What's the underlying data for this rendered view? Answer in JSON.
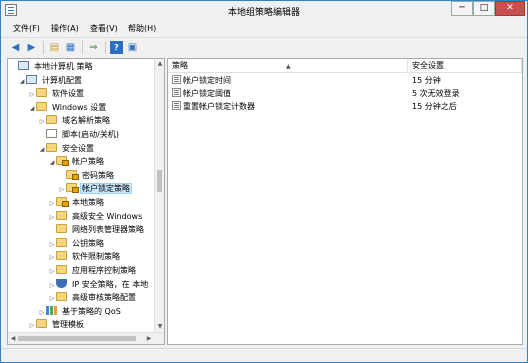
{
  "window": {
    "title": "本地组策略编辑器",
    "controls": {
      "minimize": "─",
      "maximize": "□",
      "close": "✕"
    }
  },
  "menubar": {
    "items": [
      {
        "label": "文件(F)"
      },
      {
        "label": "操作(A)"
      },
      {
        "label": "查看(V)"
      },
      {
        "label": "帮助(H)"
      }
    ]
  },
  "toolbar": {
    "back_icon": "back-arrow-icon",
    "forward_icon": "forward-arrow-icon",
    "up_icon": "up-folder-icon",
    "show_tree_icon": "show-hide-tree-icon",
    "export_icon": "export-list-icon",
    "help_icon": "help-icon",
    "properties_icon": "properties-icon"
  },
  "tree": [
    {
      "label": "本地计算机 策略",
      "icon": "computer",
      "expander": "",
      "selected": false
    },
    {
      "label": "计算机配置",
      "icon": "computer",
      "expander": "◢",
      "selected": false
    },
    {
      "label": "软件设置",
      "icon": "folder",
      "expander": "▷",
      "selected": false
    },
    {
      "label": "Windows 设置",
      "icon": "folder",
      "expander": "◢",
      "selected": false
    },
    {
      "label": "域名解析策略",
      "icon": "folder",
      "expander": "▷",
      "selected": false
    },
    {
      "label": "脚本(启动/关机)",
      "icon": "doc",
      "expander": "",
      "selected": false
    },
    {
      "label": "安全设置",
      "icon": "folder",
      "expander": "◢",
      "selected": false
    },
    {
      "label": "帐户策略",
      "icon": "folder-lock",
      "expander": "◢",
      "selected": false
    },
    {
      "label": "密码策略",
      "icon": "folder-lock",
      "expander": "",
      "selected": false
    },
    {
      "label": "帐户锁定策略",
      "icon": "folder-lock",
      "expander": "▷",
      "selected": true
    },
    {
      "label": "本地策略",
      "icon": "folder-lock",
      "expander": "▷",
      "selected": false
    },
    {
      "label": "高级安全 Windows",
      "icon": "folder",
      "expander": "▷",
      "selected": false
    },
    {
      "label": "网络列表管理器策略",
      "icon": "folder",
      "expander": "",
      "selected": false
    },
    {
      "label": "公钥策略",
      "icon": "folder",
      "expander": "▷",
      "selected": false
    },
    {
      "label": "软件限制策略",
      "icon": "folder",
      "expander": "▷",
      "selected": false
    },
    {
      "label": "应用程序控制策略",
      "icon": "folder",
      "expander": "▷",
      "selected": false
    },
    {
      "label": "IP 安全策略，在 本地",
      "icon": "shield",
      "expander": "▷",
      "selected": false
    },
    {
      "label": "高级审核策略配置",
      "icon": "folder",
      "expander": "▷",
      "selected": false
    },
    {
      "label": "基于策略的 QoS",
      "icon": "chart",
      "expander": "▷",
      "selected": false
    },
    {
      "label": "管理模板",
      "icon": "folder",
      "expander": "▷",
      "selected": false
    }
  ],
  "list": {
    "columns": {
      "policy": "策略",
      "setting": "安全设置"
    },
    "rows": [
      {
        "policy": "帐户锁定时间",
        "setting": "15 分钟"
      },
      {
        "policy": "帐户锁定阈值",
        "setting": "5 次无效登录"
      },
      {
        "policy": "重置帐户锁定计数器",
        "setting": "15 分钟之后"
      }
    ]
  }
}
